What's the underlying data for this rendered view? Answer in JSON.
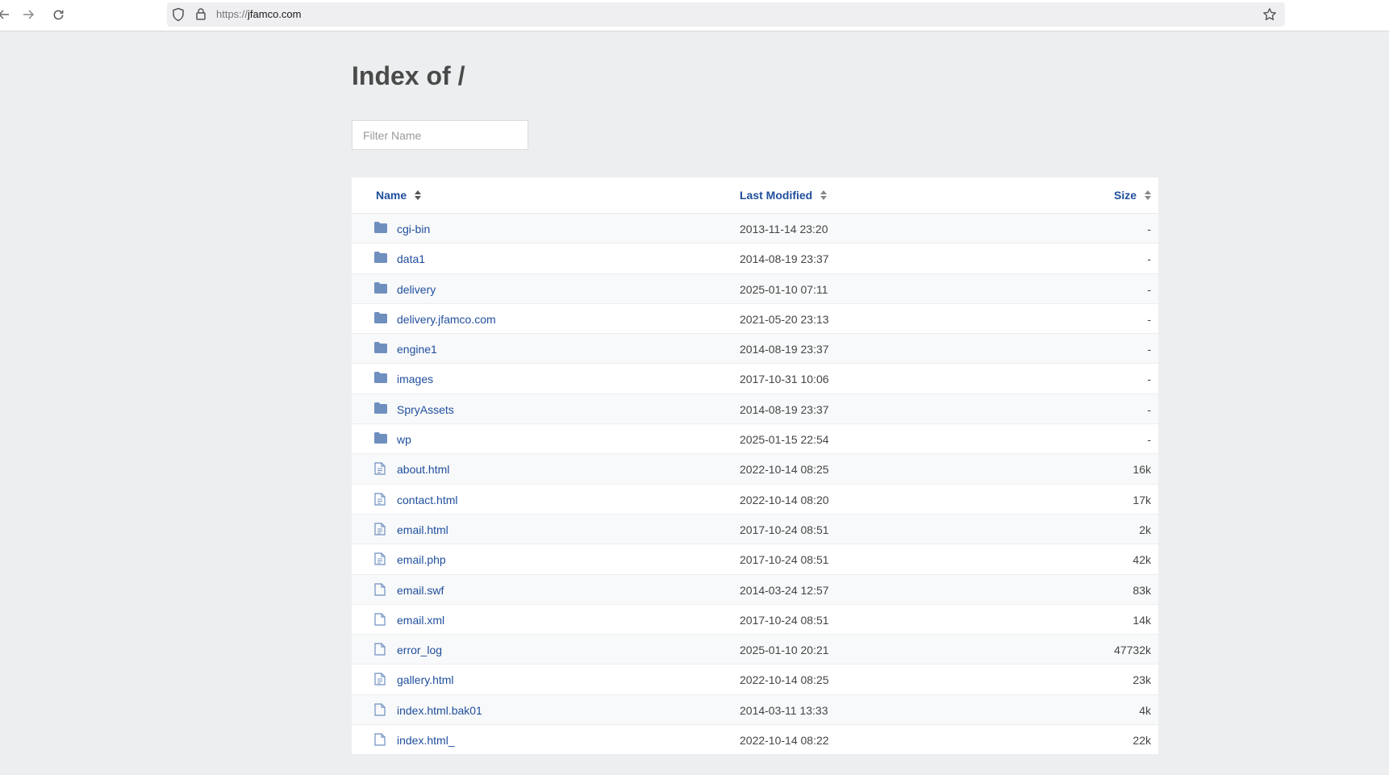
{
  "browser": {
    "url_scheme": "https://",
    "url_host": "jfamco.com",
    "back_icon": "arrow-left-icon",
    "forward_icon": "arrow-right-icon",
    "reload_icon": "reload-icon",
    "shield_icon": "shield-icon",
    "lock_icon": "lock-icon",
    "bookmark_icon": "star-icon"
  },
  "page": {
    "title": "Index of /",
    "filter_placeholder": "Filter Name"
  },
  "table": {
    "headers": {
      "name": "Name",
      "modified": "Last Modified",
      "size": "Size"
    },
    "rows": [
      {
        "type": "folder",
        "name": "cgi-bin",
        "modified": "2013-11-14 23:20",
        "size": "-"
      },
      {
        "type": "folder",
        "name": "data1",
        "modified": "2014-08-19 23:37",
        "size": "-"
      },
      {
        "type": "folder",
        "name": "delivery",
        "modified": "2025-01-10 07:11",
        "size": "-"
      },
      {
        "type": "folder",
        "name": "delivery.jfamco.com",
        "modified": "2021-05-20 23:13",
        "size": "-"
      },
      {
        "type": "folder",
        "name": "engine1",
        "modified": "2014-08-19 23:37",
        "size": "-"
      },
      {
        "type": "folder",
        "name": "images",
        "modified": "2017-10-31 10:06",
        "size": "-"
      },
      {
        "type": "folder",
        "name": "SpryAssets",
        "modified": "2014-08-19 23:37",
        "size": "-"
      },
      {
        "type": "folder",
        "name": "wp",
        "modified": "2025-01-15 22:54",
        "size": "-"
      },
      {
        "type": "text-file",
        "name": "about.html",
        "modified": "2022-10-14 08:25",
        "size": "16k"
      },
      {
        "type": "text-file",
        "name": "contact.html",
        "modified": "2022-10-14 08:20",
        "size": "17k"
      },
      {
        "type": "text-file",
        "name": "email.html",
        "modified": "2017-10-24 08:51",
        "size": "2k"
      },
      {
        "type": "text-file",
        "name": "email.php",
        "modified": "2017-10-24 08:51",
        "size": "42k"
      },
      {
        "type": "file",
        "name": "email.swf",
        "modified": "2014-03-24 12:57",
        "size": "83k"
      },
      {
        "type": "file",
        "name": "email.xml",
        "modified": "2017-10-24 08:51",
        "size": "14k"
      },
      {
        "type": "file",
        "name": "error_log",
        "modified": "2025-01-10 20:21",
        "size": "47732k"
      },
      {
        "type": "text-file",
        "name": "gallery.html",
        "modified": "2022-10-14 08:25",
        "size": "23k"
      },
      {
        "type": "file",
        "name": "index.html.bak01",
        "modified": "2014-03-11 13:33",
        "size": "4k"
      },
      {
        "type": "file",
        "name": "index.html_",
        "modified": "2022-10-14 08:22",
        "size": "22k"
      }
    ]
  },
  "colors": {
    "link": "#1f4e9c",
    "folder_icon": "#6f8fbf",
    "page_bg": "#eceeef"
  }
}
